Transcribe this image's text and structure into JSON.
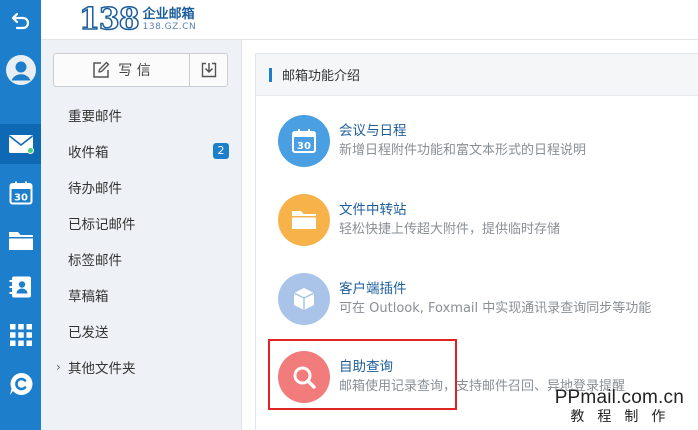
{
  "logo": {
    "number": "138",
    "name": "企业邮箱",
    "domain": "138.GZ.CN"
  },
  "toolbar": {
    "compose_label": "写 信"
  },
  "folders": [
    {
      "label": "重要邮件"
    },
    {
      "label": "收件箱",
      "badge": "2"
    },
    {
      "label": "待办邮件"
    },
    {
      "label": "已标记邮件"
    },
    {
      "label": "标签邮件"
    },
    {
      "label": "草稿箱"
    },
    {
      "label": "已发送"
    },
    {
      "label": "其他文件夹",
      "caret": "›"
    }
  ],
  "section": {
    "title": "邮箱功能介绍"
  },
  "features": [
    {
      "icon": "calendar-30-icon",
      "color": "#4a9fe3",
      "title": "会议与日程",
      "desc": "新增日程附件功能和富文本形式的日程说明"
    },
    {
      "icon": "folder-icon",
      "color": "#f7b34a",
      "title": "文件中转站",
      "desc": "轻松快捷上传超大附件，提供临时存储"
    },
    {
      "icon": "cube-icon",
      "color": "#a9c4e8",
      "title": "客户端插件",
      "desc": "可在 Outlook, Foxmail 中实现通讯录查询同步等功能"
    },
    {
      "icon": "search-icon",
      "color": "#f27b7b",
      "title": "自助查询",
      "desc": "邮箱使用记录查询，支持邮件召回、异地登录提醒"
    }
  ],
  "calendar_number": "30",
  "rail_calendar_number": "30",
  "watermark": {
    "url": "PPmail.com.cn",
    "sub": "教程制作"
  },
  "colors": {
    "rail": "#1d7fcb",
    "accent": "#1d5e9c",
    "highlight": "#e02424"
  }
}
